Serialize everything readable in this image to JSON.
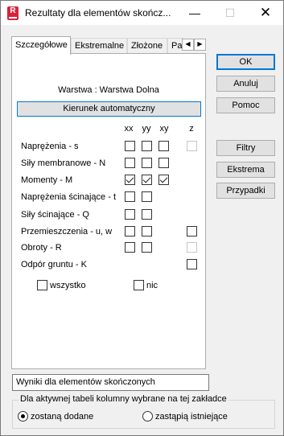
{
  "window": {
    "title": "Rezultaty dla elementów skończ...",
    "app_icon": "R",
    "minimize": "—",
    "maximize": "☐",
    "close": "✕"
  },
  "tabs": [
    {
      "label": "Szczegółowe",
      "active": true
    },
    {
      "label": "Ekstremalne",
      "active": false
    },
    {
      "label": "Złożone",
      "active": false
    },
    {
      "label": "Pa",
      "active": false
    }
  ],
  "tab_scroll": {
    "left": "◀",
    "right": "▶"
  },
  "panel": {
    "layer_text": "Warstwa : Warstwa Dolna",
    "auto_direction_button": "Kierunek automatyczny",
    "columns": [
      "xx",
      "yy",
      "xy",
      "z"
    ],
    "rows": [
      {
        "label": "Naprężenia - s",
        "xx": "unchecked",
        "yy": "unchecked",
        "xy": "unchecked",
        "z": "disabled"
      },
      {
        "label": "Siły membranowe - N",
        "xx": "unchecked",
        "yy": "unchecked",
        "xy": "unchecked",
        "z": "none"
      },
      {
        "label": "Momenty - M",
        "xx": "checked",
        "yy": "checked",
        "xy": "checked",
        "z": "none"
      },
      {
        "label": "Naprężenia ścinające - t",
        "xx": "unchecked",
        "yy": "unchecked",
        "xy": "none",
        "z": "none"
      },
      {
        "label": "Siły ścinające - Q",
        "xx": "unchecked",
        "yy": "unchecked",
        "xy": "none",
        "z": "none"
      },
      {
        "label": "Przemieszczenia - u, w",
        "xx": "unchecked",
        "yy": "unchecked",
        "xy": "none",
        "z": "unchecked"
      },
      {
        "label": "Obroty - R",
        "xx": "unchecked",
        "yy": "unchecked",
        "xy": "none",
        "z": "disabled"
      },
      {
        "label": "Odpór gruntu - K",
        "xx": "none",
        "yy": "none",
        "xy": "none",
        "z": "unchecked"
      }
    ],
    "select_all_label": "wszystko",
    "select_none_label": "nic"
  },
  "buttons": {
    "ok": "OK",
    "cancel": "Anuluj",
    "help": "Pomoc",
    "filters": "Filtry",
    "extremes": "Ekstrema",
    "cases": "Przypadki"
  },
  "info_text": "Wyniki dla elementów skończonych",
  "columns_group": {
    "caption": "Dla aktywnej tabeli kolumny wybrane na tej zakładce",
    "options": [
      {
        "label": "zostaną dodane",
        "selected": true
      },
      {
        "label": "zastąpią istniejące",
        "selected": false
      }
    ]
  }
}
